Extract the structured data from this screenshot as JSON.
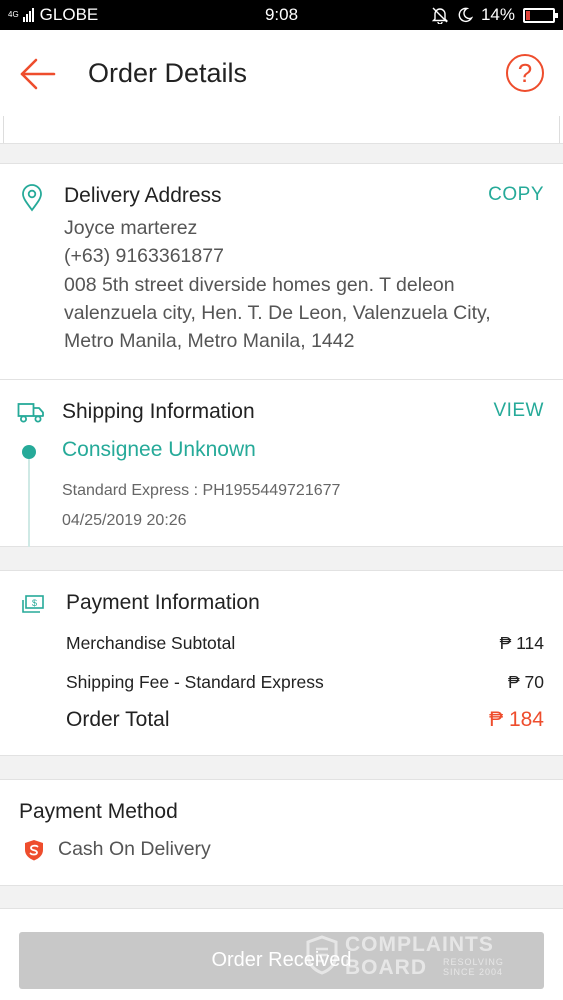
{
  "status_bar": {
    "network_type": "4G",
    "carrier": "GLOBE",
    "time": "9:08",
    "battery": "14%",
    "battery_level": 0.14
  },
  "header": {
    "title": "Order Details",
    "help_symbol": "?"
  },
  "delivery_address": {
    "title": "Delivery Address",
    "action": "COPY",
    "name": "Joyce marterez",
    "phone": "(+63) 9163361877",
    "address_line1": "008 5th street diverside homes gen. T deleon",
    "address_line2": "valenzuela city, Hen. T. De Leon, Valenzuela City,",
    "address_line3": "Metro Manila, Metro Manila, 1442"
  },
  "shipping": {
    "title": "Shipping Information",
    "action": "VIEW",
    "status": "Consignee Unknown",
    "tracking": "Standard Express :  PH1955449721677",
    "timestamp": "04/25/2019 20:26"
  },
  "payment": {
    "title": "Payment Information",
    "subtotal_label": "Merchandise Subtotal",
    "subtotal_value": "₱ 114",
    "shipping_label": "Shipping Fee - Standard Express",
    "shipping_value": "₱ 70",
    "total_label": "Order Total",
    "total_value": "₱ 184"
  },
  "payment_method": {
    "title": "Payment Method",
    "method": "Cash On Delivery"
  },
  "footer": {
    "button_label": "Order Received"
  },
  "watermark": {
    "line1": "COMPLAINTS",
    "line2": "BOARD",
    "tagline1": "RESOLVING",
    "tagline2": "SINCE 2004"
  },
  "colors": {
    "accent": "#ee4d2d",
    "teal": "#26aa99",
    "disabled_button": "#c8c8c8"
  },
  "icons": {
    "back": "arrow-left-icon",
    "help": "question-circle-icon",
    "address": "location-pin-icon",
    "shipping": "truck-icon",
    "payment": "banknote-icon",
    "method": "shopee-shield-icon",
    "bell_off": "bell-off-icon",
    "moon": "moon-icon",
    "battery": "battery-icon"
  }
}
